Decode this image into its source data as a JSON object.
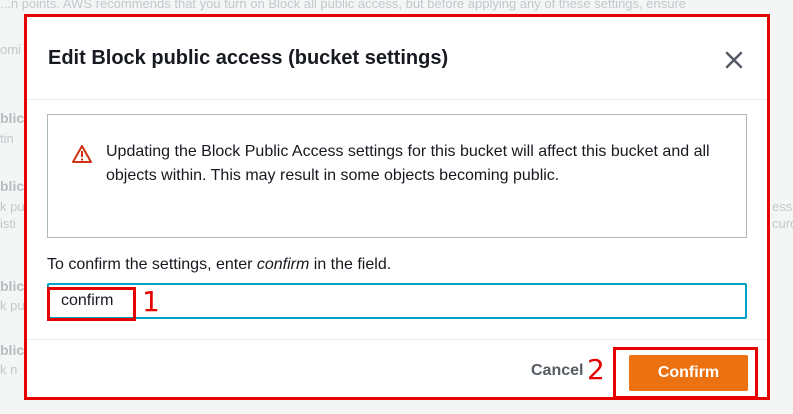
{
  "background": {
    "top_line": "...n points. AWS recommends that you turn on Block all public access, but before applying any of these settings, ensure",
    "fragments": [
      "omi",
      "blic",
      "tin",
      "blic",
      "k pu",
      "isti",
      "blic",
      "k pu",
      "blic",
      "k n",
      "ess",
      "curo"
    ]
  },
  "dialog": {
    "title": "Edit Block public access (bucket settings)",
    "close_icon": "close-icon",
    "alert": {
      "icon": "warning-triangle-icon",
      "icon_color": "#d13212",
      "text": "Updating the Block Public Access settings for this bucket will affect this bucket and all objects within. This may result in some objects becoming public."
    },
    "confirm_prompt": {
      "before": "To confirm the settings, enter ",
      "keyword": "confirm",
      "after": " in the field."
    },
    "input": {
      "value": "confirm",
      "placeholder": ""
    },
    "footer": {
      "cancel_label": "Cancel",
      "confirm_label": "Confirm",
      "confirm_color": "#ec7211"
    }
  },
  "annotations": {
    "step1": "1",
    "step2": "2",
    "color": "#e60000"
  }
}
